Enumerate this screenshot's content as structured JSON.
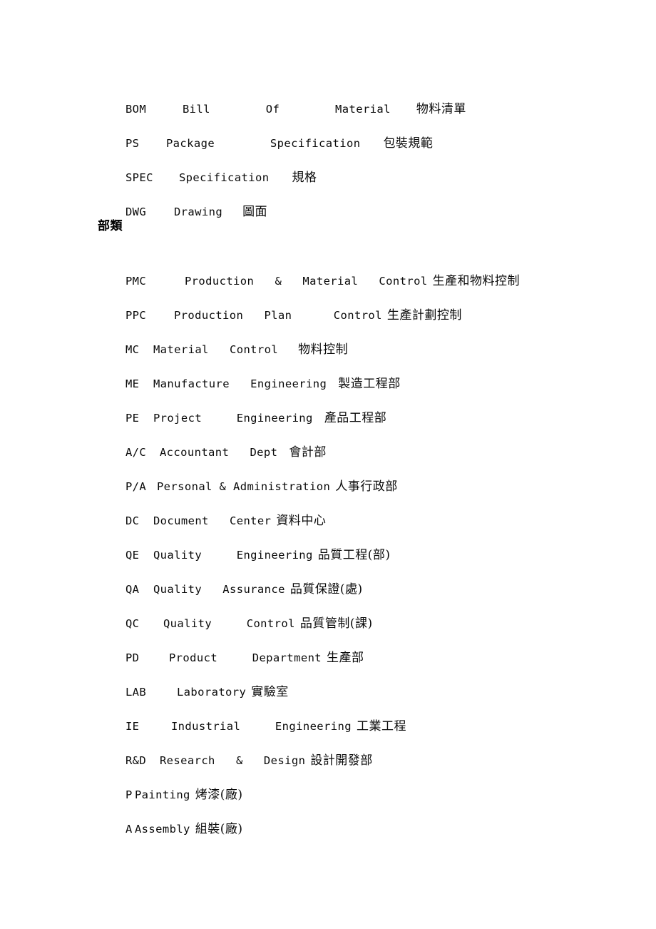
{
  "document": {
    "background_color": "#ffffff",
    "text_color": "#0a0a0a",
    "sections": [
      {
        "id": "documents",
        "heading": null,
        "entries": [
          {
            "abbr": "BOM",
            "expansion_parts": [
              "Bill",
              "Of",
              "Material"
            ],
            "chinese": "物料清單",
            "full_line": "BOM        Bill        Of        Material    物料清單"
          },
          {
            "abbr": "PS",
            "expansion_parts": [
              "Package",
              "Specification"
            ],
            "chinese": "包裝規範",
            "full_line": "PS    Package        Specification     包裝規範"
          },
          {
            "abbr": "SPEC",
            "expansion_parts": [
              "Specification"
            ],
            "chinese": "規格",
            "full_line": "SPEC     Specification     規格"
          },
          {
            "abbr": "DWG",
            "expansion_parts": [
              "Drawing"
            ],
            "chinese": "圖面",
            "full_line": "DWG    Drawing     圖面"
          }
        ]
      },
      {
        "id": "departments",
        "heading": "部類",
        "entries": [
          {
            "abbr": "PMC",
            "expansion_parts": [
              "Production",
              "&",
              "Material",
              "Control"
            ],
            "chinese": "生產和物料控制",
            "full_line": "PMC        Production   &    Material   Control 生產和物料控制"
          },
          {
            "abbr": "PPC",
            "expansion_parts": [
              "Production",
              "Plan",
              "Control"
            ],
            "chinese": "生產計劃控制",
            "full_line": "PPC    Production   Plan      Control 生產計劃控制"
          },
          {
            "abbr": "MC",
            "expansion_parts": [
              "Material",
              "Control"
            ],
            "chinese": "物料控制",
            "full_line": "MC   Material   Control     物料控制"
          },
          {
            "abbr": "ME",
            "expansion_parts": [
              "Manufacture",
              "Engineering"
            ],
            "chinese": "製造工程部",
            "full_line": "ME   Manufacture   Engineering    製造工程部"
          },
          {
            "abbr": "PE",
            "expansion_parts": [
              "Project",
              "Engineering"
            ],
            "chinese": "產品工程部",
            "full_line": "PE   Project     Engineering    產品工程部"
          },
          {
            "abbr": "A/C",
            "expansion_parts": [
              "Accountant",
              "Dept"
            ],
            "chinese": "會計部",
            "full_line": "A/C   Accountant   Dept    會計部"
          },
          {
            "abbr": "P/A",
            "expansion_parts": [
              "Personal & Administration"
            ],
            "chinese": "人事行政部",
            "full_line": "P/A   Personal & Administration 人事行政部"
          },
          {
            "abbr": "DC",
            "expansion_parts": [
              "Document",
              "Center"
            ],
            "chinese": "資料中心",
            "full_line": "DC   Document   Center 資料中心"
          },
          {
            "abbr": "QE",
            "expansion_parts": [
              "Quality",
              "Engineering"
            ],
            "chinese": "品質工程(部)",
            "full_line": "QE   Quality     Engineering 品質工程(部)"
          },
          {
            "abbr": "QA",
            "expansion_parts": [
              "Quality",
              "Assurance"
            ],
            "chinese": "品質保證(處)",
            "full_line": "QA   Quality   Assurance 品質保證(處)"
          },
          {
            "abbr": "QC",
            "expansion_parts": [
              "Quality",
              "Control"
            ],
            "chinese": "品質管制(課)",
            "full_line": "QC    Quality     Control 品質管制(課)"
          },
          {
            "abbr": "PD",
            "expansion_parts": [
              "Product",
              "Department"
            ],
            "chinese": "生產部",
            "full_line": "PD    Product     Department 生產部"
          },
          {
            "abbr": "LAB",
            "expansion_parts": [
              "Laboratory"
            ],
            "chinese": "實驗室",
            "full_line": "LAB     Laboratory 實驗室"
          },
          {
            "abbr": "IE",
            "expansion_parts": [
              "Industrial",
              "Engineering"
            ],
            "chinese": "工業工程",
            "full_line": "IE    Industrial     Engineering 工業工程"
          },
          {
            "abbr": "R&D",
            "expansion_parts": [
              "Research",
              "&",
              "Design"
            ],
            "chinese": "設計開發部",
            "full_line": "R&D   Research   &   Design 設計開發部"
          },
          {
            "abbr": "P",
            "expansion_parts": [
              "Painting"
            ],
            "chinese": "烤漆(廠)",
            "full_line": "P Painting 烤漆(廠)"
          },
          {
            "abbr": "A",
            "expansion_parts": [
              "Assembly"
            ],
            "chinese": "組裝(廠)",
            "full_line": "A Assembly 組裝(廠)"
          }
        ]
      }
    ]
  },
  "lines": {
    "l0": {
      "abbr": "BOM",
      "mid": "Bill        Of        Material",
      "cjk": "物料清單"
    },
    "l1": {
      "abbr": "PS",
      "mid": "Package        Specification",
      "cjk": "包裝規範"
    },
    "l2": {
      "abbr": "SPEC",
      "mid": "Specification",
      "cjk": "規格"
    },
    "l3": {
      "abbr": "DWG",
      "mid": "Drawing",
      "cjk": "圖面"
    },
    "heading": "部類",
    "l4": {
      "abbr": "PMC",
      "mid": "Production   &   Material   Control",
      "cjk": "生產和物料控制"
    },
    "l5": {
      "abbr": "PPC",
      "mid": "Production   Plan      Control",
      "cjk": "生產計劃控制"
    },
    "l6": {
      "abbr": "MC",
      "mid": "Material   Control",
      "cjk": "物料控制"
    },
    "l7": {
      "abbr": "ME",
      "mid": "Manufacture   Engineering",
      "cjk": "製造工程部"
    },
    "l8": {
      "abbr": "PE",
      "mid": "Project     Engineering",
      "cjk": "產品工程部"
    },
    "l9": {
      "abbr": "A/C",
      "mid": "Accountant   Dept",
      "cjk": "會計部"
    },
    "l10": {
      "abbr": "P/A",
      "mid": "Personal & Administration",
      "cjk": "人事行政部"
    },
    "l11": {
      "abbr": "DC",
      "mid": "Document   Center",
      "cjk": "資料中心"
    },
    "l12": {
      "abbr": "QE",
      "mid": "Quality     Engineering",
      "cjk": "品質工程(部)"
    },
    "l13": {
      "abbr": "QA",
      "mid": "Quality   Assurance",
      "cjk": "品質保證(處)"
    },
    "l14": {
      "abbr": "QC",
      "mid": "Quality     Control",
      "cjk": "品質管制(課)"
    },
    "l15": {
      "abbr": "PD",
      "mid": "Product     Department",
      "cjk": "生產部"
    },
    "l16": {
      "abbr": "LAB",
      "mid": "Laboratory",
      "cjk": "實驗室"
    },
    "l17": {
      "abbr": "IE",
      "mid": "Industrial     Engineering",
      "cjk": "工業工程"
    },
    "l18": {
      "abbr": "R&D",
      "mid": "Research   &   Design",
      "cjk": "設計開發部"
    },
    "l19": {
      "abbr": "P",
      "mid": "Painting",
      "cjk": "烤漆(廠)"
    },
    "l20": {
      "abbr": "A",
      "mid": "Assembly",
      "cjk": "組裝(廠)"
    }
  }
}
